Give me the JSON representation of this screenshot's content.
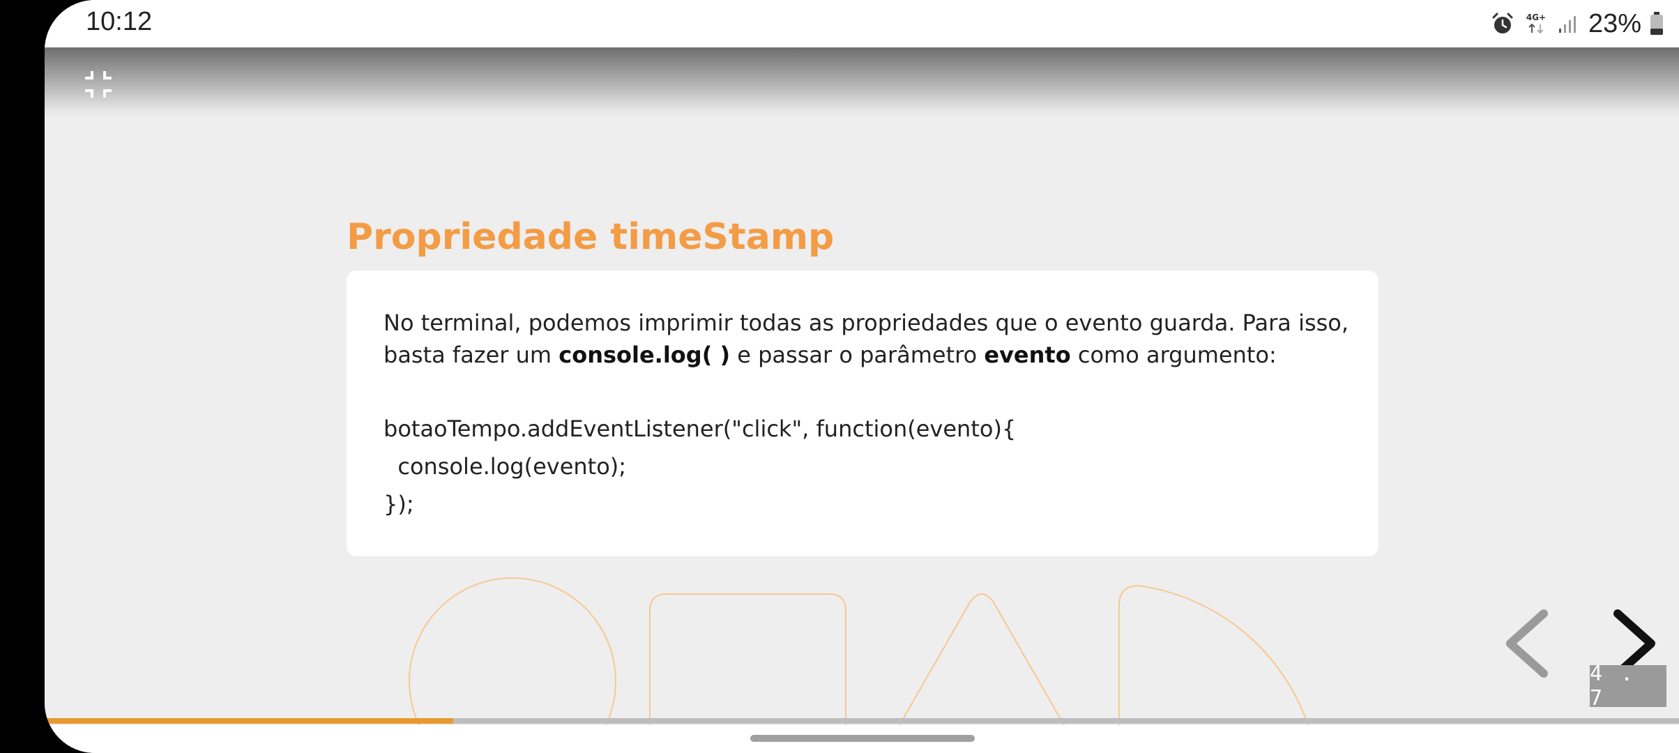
{
  "status_bar": {
    "time": "10:12",
    "network": "4G+",
    "battery": "23%"
  },
  "slide": {
    "title": "Propriedade timeStamp",
    "text_part1": "No terminal, podemos imprimir todas as propriedades que o evento guarda. Para isso, basta fazer um ",
    "text_bold1": "console.log( )",
    "text_part2": " e passar o parâmetro ",
    "text_bold2": "evento",
    "text_part3": " como argumento:",
    "code_lines": [
      "botaoTempo.addEventListener(\"click\", function(evento){",
      "  console.log(evento);",
      "});"
    ]
  },
  "navigation": {
    "slide_number": "4 . 7",
    "progress": 0.25
  },
  "colors": {
    "title": "#f39c45",
    "progress": "#e89a2e",
    "shapes": "#f6c894"
  }
}
